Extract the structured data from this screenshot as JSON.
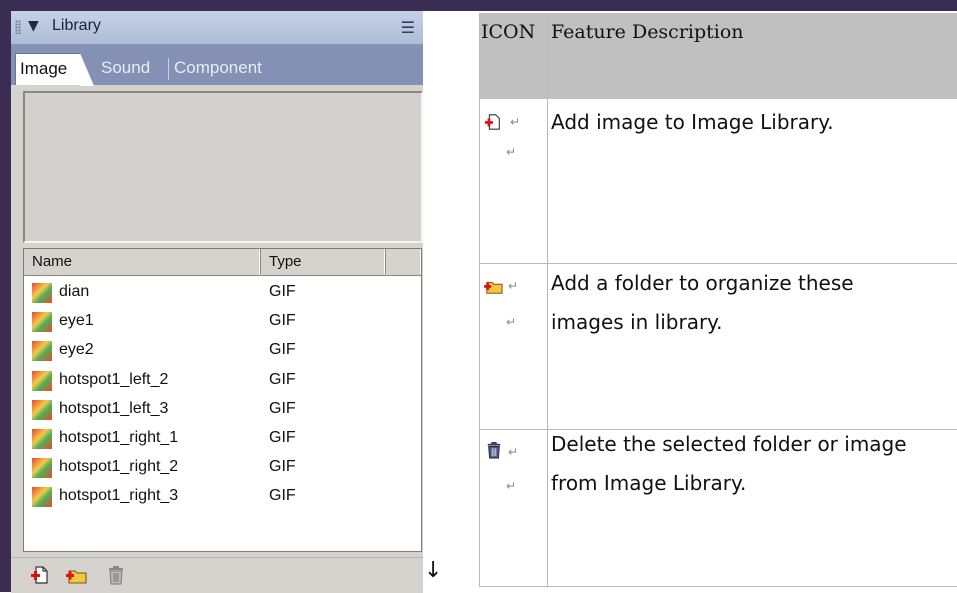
{
  "library_panel": {
    "title": "Library",
    "tabs": [
      {
        "label": "Image",
        "selected": true
      },
      {
        "label": "Sound",
        "selected": false
      },
      {
        "label": "Component",
        "selected": false
      }
    ],
    "columns": [
      "Name",
      "Type"
    ],
    "rows": [
      {
        "name": "dian",
        "type": "GIF"
      },
      {
        "name": "eye1",
        "type": "GIF"
      },
      {
        "name": "eye2",
        "type": "GIF"
      },
      {
        "name": "hotspot1_left_2",
        "type": "GIF"
      },
      {
        "name": "hotspot1_left_3",
        "type": "GIF"
      },
      {
        "name": "hotspot1_right_1",
        "type": "GIF"
      },
      {
        "name": "hotspot1_right_2",
        "type": "GIF"
      },
      {
        "name": "hotspot1_right_3",
        "type": "GIF"
      }
    ],
    "toolbar_icons": [
      "add-image-icon",
      "add-folder-icon",
      "delete-icon"
    ]
  },
  "feature_table": {
    "headers": {
      "icon": "ICON",
      "description": "Feature Description"
    },
    "rows": [
      {
        "icon": "add-image-icon",
        "description_lines": [
          "Add image to Image Library."
        ]
      },
      {
        "icon": "add-folder-icon",
        "description_lines": [
          "Add a folder to organize these",
          "images in library."
        ]
      },
      {
        "icon": "delete-icon",
        "description_lines": [
          "Delete the selected folder or image",
          "from Image Library."
        ]
      }
    ]
  },
  "colors": {
    "frame": "#3a2c52",
    "tab_bar": "#8490b4",
    "panel_bg": "#d6d3ce",
    "table_header": "#c0c0c0"
  }
}
